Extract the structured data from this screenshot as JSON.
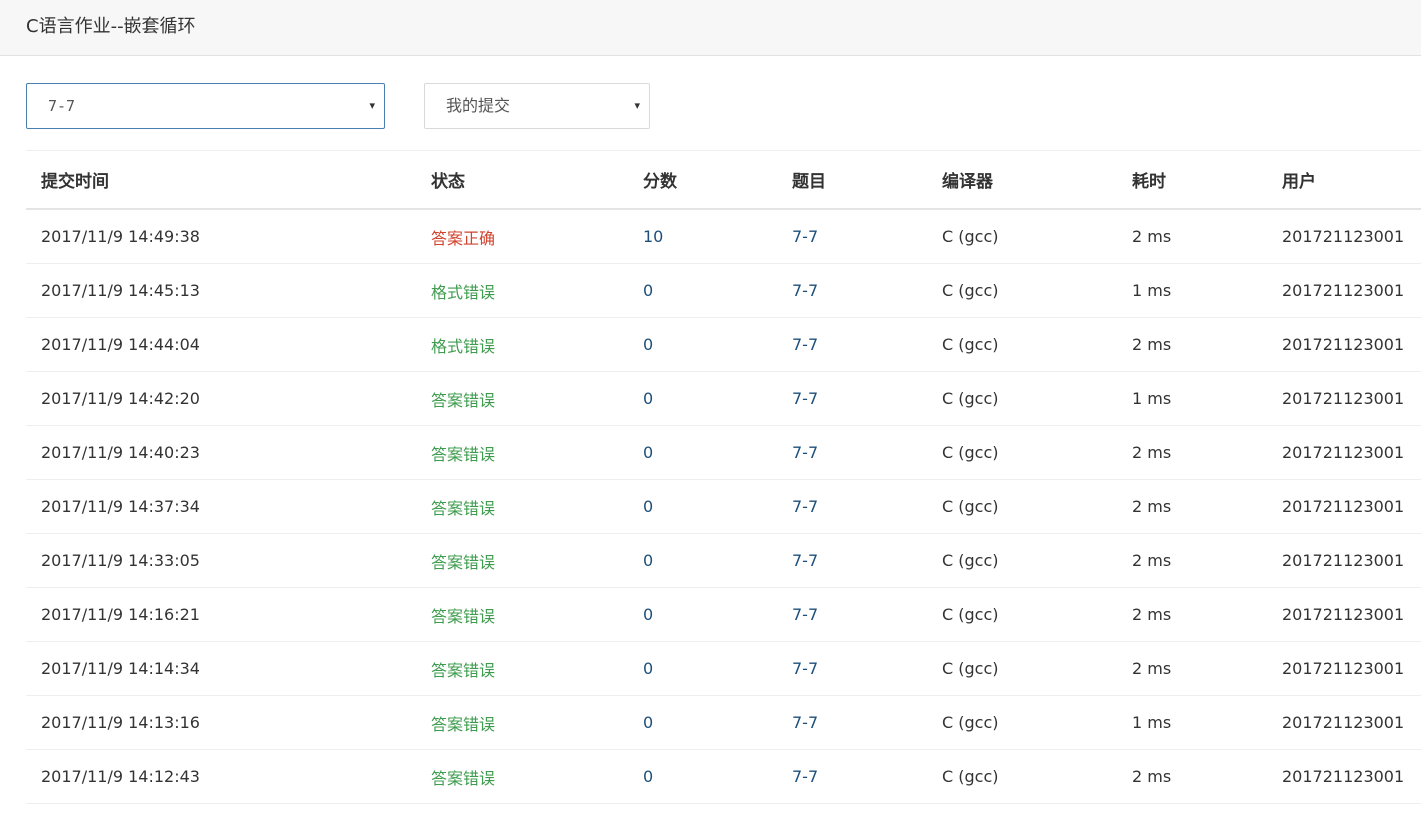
{
  "header": {
    "title": "C语言作业--嵌套循环"
  },
  "filters": {
    "problem_select": "7-7",
    "scope_select": "我的提交",
    "caret": "▾"
  },
  "table": {
    "columns": [
      "提交时间",
      "状态",
      "分数",
      "题目",
      "编译器",
      "耗时",
      "用户"
    ],
    "rows": [
      {
        "time": "2017/11/9 14:49:38",
        "status": "答案正确",
        "status_type": "correct",
        "score": "10",
        "problem": "7-7",
        "compiler": "C (gcc)",
        "duration": "2 ms",
        "user": "201721123001"
      },
      {
        "time": "2017/11/9 14:45:13",
        "status": "格式错误",
        "status_type": "wrong",
        "score": "0",
        "problem": "7-7",
        "compiler": "C (gcc)",
        "duration": "1 ms",
        "user": "201721123001"
      },
      {
        "time": "2017/11/9 14:44:04",
        "status": "格式错误",
        "status_type": "wrong",
        "score": "0",
        "problem": "7-7",
        "compiler": "C (gcc)",
        "duration": "2 ms",
        "user": "201721123001"
      },
      {
        "time": "2017/11/9 14:42:20",
        "status": "答案错误",
        "status_type": "wrong",
        "score": "0",
        "problem": "7-7",
        "compiler": "C (gcc)",
        "duration": "1 ms",
        "user": "201721123001"
      },
      {
        "time": "2017/11/9 14:40:23",
        "status": "答案错误",
        "status_type": "wrong",
        "score": "0",
        "problem": "7-7",
        "compiler": "C (gcc)",
        "duration": "2 ms",
        "user": "201721123001"
      },
      {
        "time": "2017/11/9 14:37:34",
        "status": "答案错误",
        "status_type": "wrong",
        "score": "0",
        "problem": "7-7",
        "compiler": "C (gcc)",
        "duration": "2 ms",
        "user": "201721123001"
      },
      {
        "time": "2017/11/9 14:33:05",
        "status": "答案错误",
        "status_type": "wrong",
        "score": "0",
        "problem": "7-7",
        "compiler": "C (gcc)",
        "duration": "2 ms",
        "user": "201721123001"
      },
      {
        "time": "2017/11/9 14:16:21",
        "status": "答案错误",
        "status_type": "wrong",
        "score": "0",
        "problem": "7-7",
        "compiler": "C (gcc)",
        "duration": "2 ms",
        "user": "201721123001"
      },
      {
        "time": "2017/11/9 14:14:34",
        "status": "答案错误",
        "status_type": "wrong",
        "score": "0",
        "problem": "7-7",
        "compiler": "C (gcc)",
        "duration": "2 ms",
        "user": "201721123001"
      },
      {
        "time": "2017/11/9 14:13:16",
        "status": "答案错误",
        "status_type": "wrong",
        "score": "0",
        "problem": "7-7",
        "compiler": "C (gcc)",
        "duration": "1 ms",
        "user": "201721123001"
      },
      {
        "time": "2017/11/9 14:12:43",
        "status": "答案错误",
        "status_type": "wrong",
        "score": "0",
        "problem": "7-7",
        "compiler": "C (gcc)",
        "duration": "2 ms",
        "user": "201721123001"
      }
    ]
  },
  "colors": {
    "correct": "#d0432e",
    "wrong": "#3f9c4f",
    "link": "#1d4f7a"
  }
}
